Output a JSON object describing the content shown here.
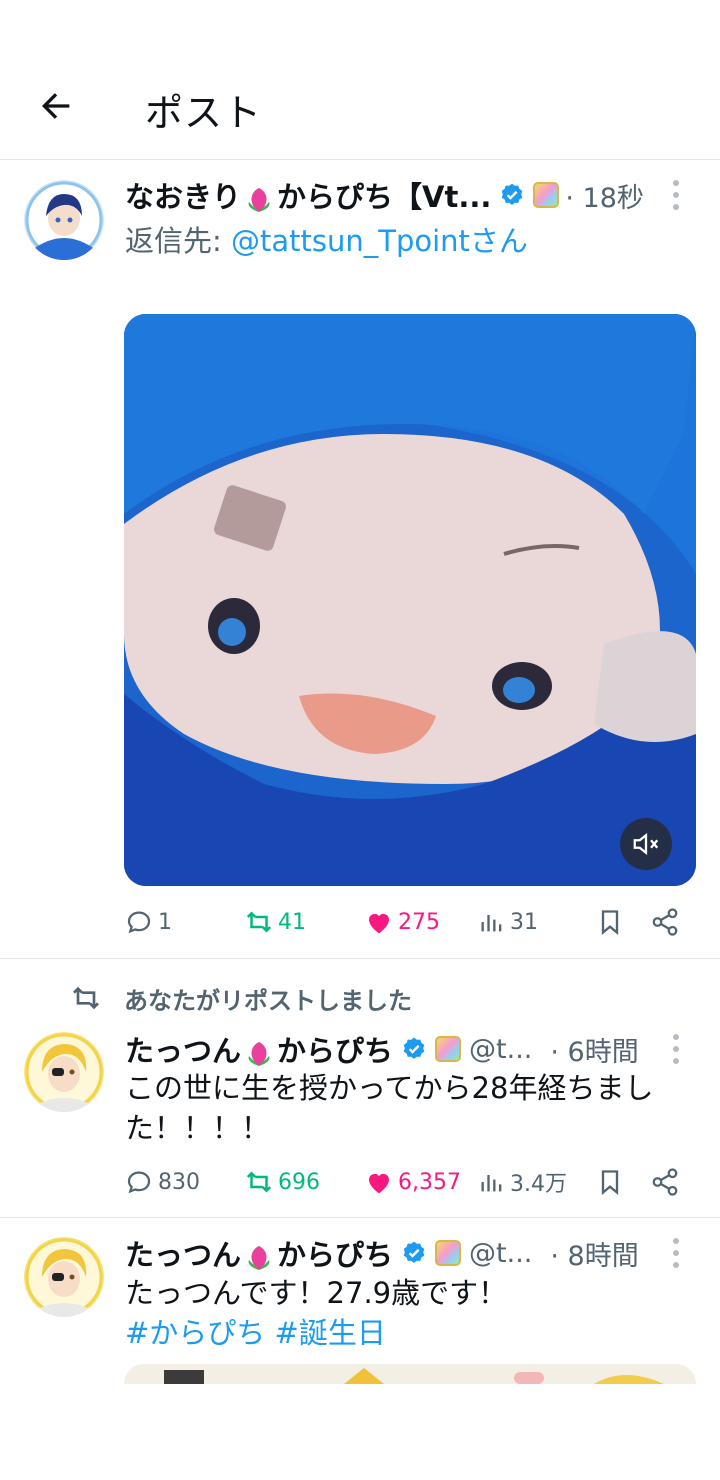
{
  "header": {
    "title": "ポスト"
  },
  "main_post": {
    "name_prefix": "なおきり",
    "name_suffix": "からぴち【Vt...",
    "time": "· 18秒",
    "reply_label": "返信先: ",
    "reply_handle": "@tattsun_Tpointさん",
    "stats": {
      "replies": "1",
      "reposts": "41",
      "likes": "275",
      "views": "31"
    }
  },
  "repost_banner": "あなたがリポストしました",
  "post2": {
    "name_prefix": "たっつん",
    "name_suffix": "からぴち",
    "handle": "@t...",
    "time": "· 6時間",
    "text": "この世に生を授かってから28年経ちました！！！！",
    "stats": {
      "replies": "830",
      "reposts": "696",
      "likes": "6,357",
      "views": "3.4万"
    }
  },
  "post3": {
    "name_prefix": "たっつん",
    "name_suffix": "からぴち",
    "handle": "@t...",
    "time": "· 8時間",
    "text": "たっつんです！27.9歳です！",
    "hashtags": "#からぴち #誕生日"
  },
  "colors": {
    "accent": "#1d9bf0",
    "repost": "#00ba7c",
    "like": "#f91880",
    "muted": "#536471"
  },
  "icons": [
    "back-arrow-icon",
    "verified-icon",
    "affiliate-icon",
    "peach-icon",
    "more-icon",
    "mute-icon",
    "reply-icon",
    "repost-icon",
    "like-icon",
    "views-icon",
    "bookmark-icon",
    "share-icon"
  ]
}
